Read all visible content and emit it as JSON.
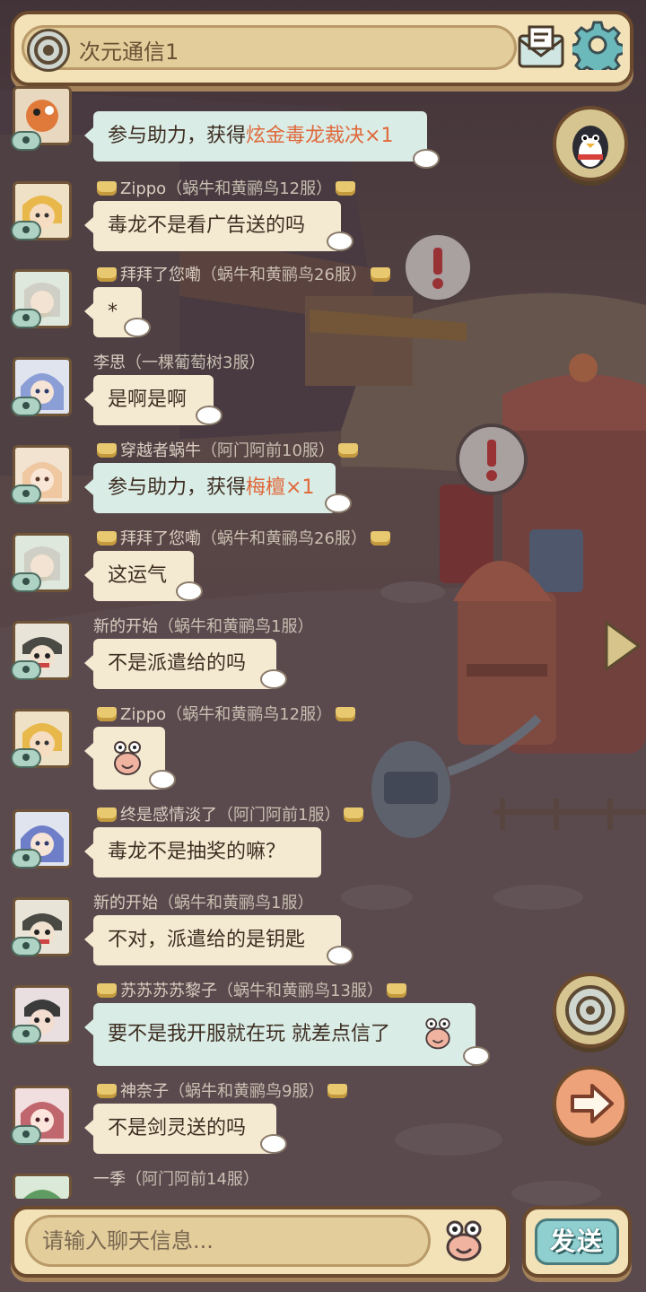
{
  "header": {
    "channel_title": "次元通信1",
    "mail_icon": "mail-icon",
    "settings_icon": "gear-icon"
  },
  "messages": [
    {
      "sender": "",
      "server": "",
      "text_prefix": "参与助力，获得",
      "text_highlight": "炫金毒龙裁决×1",
      "text_suffix": ""
    },
    {
      "sender": "Zippo",
      "server": "（蜗牛和黄鹂鸟12服）",
      "text": "毒龙不是看广告送的吗"
    },
    {
      "sender": "拜拜了您嘞",
      "server": "（蜗牛和黄鹂鸟26服）",
      "text": "*"
    },
    {
      "sender": "李思",
      "server": "（一棵葡萄树3服）",
      "text": "是啊是啊"
    },
    {
      "sender": "穿越者蜗牛",
      "server": "（阿门阿前10服）",
      "text_prefix": "参与助力，获得",
      "text_highlight": "梅檀×1",
      "text_suffix": ""
    },
    {
      "sender": "拜拜了您嘞",
      "server": "（蜗牛和黄鹂鸟26服）",
      "text": "这运气"
    },
    {
      "sender": "新的开始",
      "server": "（蜗牛和黄鹂鸟1服）",
      "text": "不是派遣给的吗"
    },
    {
      "sender": "Zippo",
      "server": "（蜗牛和黄鹂鸟12服）",
      "text": ""
    },
    {
      "sender": "终是感情淡了",
      "server": "（阿门阿前1服）",
      "text": "毒龙不是抽奖的嘛？"
    },
    {
      "sender": "新的开始",
      "server": "（蜗牛和黄鹂鸟1服）",
      "text": "不对，派遣给的是钥匙"
    },
    {
      "sender": "苏苏苏苏黎子",
      "server": "（蜗牛和黄鹂鸟13服）",
      "text": "要不是我开服就在玩  就差点信了"
    },
    {
      "sender": "神奈子",
      "server": "（蜗牛和黄鹂鸟9服）",
      "text": "不是剑灵送的吗"
    },
    {
      "sender": "一季",
      "server": "（阿门阿前14服）",
      "text": ""
    }
  ],
  "input": {
    "placeholder": "请输入聊天信息...",
    "value": ""
  },
  "send_label": "发送",
  "colors": {
    "panel": "#f3e2b8",
    "panel_border": "#6b4a2e",
    "bubble": "#f4ead1",
    "bubble_system": "#d9ece6",
    "highlight": "#e0683a",
    "send_button": "#8fcfd0"
  },
  "side_buttons": [
    "penguin-icon",
    "target-icon",
    "arrow-right-icon"
  ]
}
